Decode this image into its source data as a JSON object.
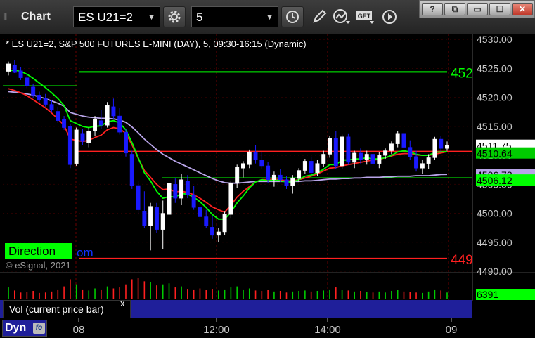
{
  "toolbar": {
    "title": "Chart",
    "symbol": "ES U21=2",
    "interval": "5"
  },
  "window_controls": {
    "help": "?",
    "restore": "⧉",
    "minimize": "▭",
    "maximize": "☐",
    "close": "✕"
  },
  "chart": {
    "header": "* ES U21=2, S&P 500 FUTURES E-MINI (DAY), 5, 09:30-16:15 (Dynamic)",
    "direction_label": "Direction",
    "direction_tail": "om",
    "copyright": "© eSignal, 2021",
    "price_ticks": [
      "4530.00",
      "4525.00",
      "4520.00",
      "4515.00",
      "4510.00",
      "4505.00",
      "4500.00",
      "4495.00",
      "4490.00"
    ],
    "time_ticks": [
      "08",
      "12:00",
      "14:00",
      "09"
    ],
    "line_labels": {
      "upper": "452",
      "lower": "449"
    },
    "price_tags": [
      {
        "text": "4511.75",
        "bg": "#ffffff",
        "fg": "#000000"
      },
      {
        "text": "4510.64",
        "bg": "#00cc00",
        "fg": "#000000"
      },
      {
        "text": "4506.72",
        "bg": "#b8a4e8",
        "fg": "#000000"
      },
      {
        "text": "4506.12",
        "bg": "#00ff00",
        "fg": "#000000"
      }
    ],
    "volume": {
      "label": "Vol (current price bar)",
      "close_glyph": "x",
      "value": "6391"
    },
    "bottom": {
      "dyn_label": "Dyn",
      "dyn_icon_text": "fo"
    },
    "colors": {
      "up_candle": "#ffffff",
      "down_candle": "#1a1aff",
      "ma_red": "#ff2020",
      "ma_green": "#00ff00",
      "ma_purple": "#b8a4e8",
      "level_green": "#00ff00",
      "level_red": "#ff2020",
      "grid": "#6a0000"
    }
  },
  "chart_data": {
    "type": "candlestick",
    "symbol": "ES U21=2",
    "ylim": [
      4490,
      4531
    ],
    "levels": {
      "upper_green": 4524.4,
      "lower_red": 4492.2,
      "red_mid": 4510.7,
      "green_mid": 4506.1
    },
    "candles": [
      [
        4524.5,
        4526.2,
        4523.8,
        4525.8
      ],
      [
        4525.6,
        4526.4,
        4524.2,
        4524.3
      ],
      [
        4524.6,
        4525.2,
        4523.0,
        4523.4
      ],
      [
        4523.4,
        4524.0,
        4521.6,
        4522.0
      ],
      [
        4521.8,
        4522.4,
        4520.0,
        4520.4
      ],
      [
        4520.4,
        4521.0,
        4519.2,
        4519.6
      ],
      [
        4519.8,
        4520.6,
        4518.4,
        4518.8
      ],
      [
        4518.8,
        4519.6,
        4517.4,
        4517.8
      ],
      [
        4517.6,
        4518.4,
        4515.6,
        4516.0
      ],
      [
        4516.2,
        4516.8,
        4514.4,
        4514.8
      ],
      [
        4515.0,
        4515.4,
        4507.8,
        4508.4
      ],
      [
        4508.6,
        4514.8,
        4508.2,
        4514.4
      ],
      [
        4513.8,
        4514.6,
        4511.8,
        4512.4
      ],
      [
        4512.2,
        4514.8,
        4511.4,
        4514.2
      ],
      [
        4514.2,
        4516.8,
        4513.4,
        4516.2
      ],
      [
        4516.0,
        4517.8,
        4514.6,
        4515.2
      ],
      [
        4515.2,
        4519.2,
        4514.8,
        4518.6
      ],
      [
        4518.4,
        4519.8,
        4516.2,
        4516.8
      ],
      [
        4516.8,
        4518.2,
        4513.6,
        4514.0
      ],
      [
        4514.0,
        4514.6,
        4509.8,
        4510.4
      ],
      [
        4510.2,
        4510.8,
        4504.2,
        4504.8
      ],
      [
        4504.8,
        4505.6,
        4499.8,
        4500.6
      ],
      [
        4500.4,
        4503.8,
        4497.4,
        4497.8
      ],
      [
        4497.8,
        4501.8,
        4493.6,
        4501.2
      ],
      [
        4501.0,
        4501.8,
        4496.6,
        4497.2
      ],
      [
        4497.2,
        4502.2,
        4493.8,
        4500.0
      ],
      [
        4499.8,
        4505.8,
        4497.4,
        4505.2
      ],
      [
        4505.0,
        4506.0,
        4501.8,
        4502.6
      ],
      [
        4502.6,
        4506.8,
        4501.4,
        4505.8
      ],
      [
        4505.6,
        4506.6,
        4502.6,
        4503.2
      ],
      [
        4503.2,
        4504.8,
        4500.6,
        4501.0
      ],
      [
        4501.0,
        4502.6,
        4498.6,
        4499.4
      ],
      [
        4499.4,
        4500.6,
        4497.4,
        4497.8
      ],
      [
        4497.6,
        4499.6,
        4495.6,
        4496.2
      ],
      [
        4496.2,
        4497.4,
        4495.0,
        4496.8
      ],
      [
        4496.8,
        4500.4,
        4496.2,
        4499.8
      ],
      [
        4499.8,
        4505.6,
        4499.2,
        4505.2
      ],
      [
        4505.2,
        4508.4,
        4504.4,
        4508.0
      ],
      [
        4507.8,
        4509.0,
        4506.2,
        4508.6
      ],
      [
        4508.4,
        4511.0,
        4507.8,
        4510.6
      ],
      [
        4510.6,
        4511.8,
        4508.6,
        4509.2
      ],
      [
        4509.2,
        4510.6,
        4507.6,
        4508.2
      ],
      [
        4508.2,
        4508.8,
        4505.2,
        4505.8
      ],
      [
        4505.8,
        4507.2,
        4504.6,
        4506.6
      ],
      [
        4506.6,
        4507.6,
        4505.4,
        4505.8
      ],
      [
        4505.8,
        4506.4,
        4504.2,
        4504.8
      ],
      [
        4504.8,
        4506.6,
        4503.4,
        4506.0
      ],
      [
        4506.0,
        4507.8,
        4505.4,
        4507.4
      ],
      [
        4507.4,
        4509.4,
        4506.8,
        4509.0
      ],
      [
        4509.0,
        4509.8,
        4506.4,
        4507.0
      ],
      [
        4507.0,
        4509.2,
        4506.4,
        4508.6
      ],
      [
        4508.6,
        4510.8,
        4508.0,
        4510.2
      ],
      [
        4510.2,
        4513.4,
        4509.6,
        4513.0
      ],
      [
        4513.0,
        4514.2,
        4507.6,
        4508.2
      ],
      [
        4508.2,
        4513.6,
        4507.6,
        4513.2
      ],
      [
        4513.2,
        4513.8,
        4508.4,
        4508.8
      ],
      [
        4508.8,
        4510.8,
        4507.8,
        4510.4
      ],
      [
        4510.4,
        4511.2,
        4508.6,
        4509.2
      ],
      [
        4509.2,
        4510.8,
        4508.4,
        4510.2
      ],
      [
        4510.2,
        4510.8,
        4508.2,
        4508.6
      ],
      [
        4508.6,
        4510.6,
        4507.8,
        4510.0
      ],
      [
        4510.0,
        4511.2,
        4509.4,
        4510.8
      ],
      [
        4510.8,
        4512.4,
        4510.2,
        4512.0
      ],
      [
        4512.0,
        4514.2,
        4511.4,
        4513.8
      ],
      [
        4513.8,
        4514.6,
        4510.8,
        4511.4
      ],
      [
        4511.4,
        4512.6,
        4509.2,
        4509.8
      ],
      [
        4509.8,
        4510.8,
        4507.2,
        4507.8
      ],
      [
        4507.8,
        4509.2,
        4506.8,
        4508.6
      ],
      [
        4508.6,
        4510.2,
        4507.6,
        4509.6
      ],
      [
        4509.6,
        4513.2,
        4509.2,
        4512.8
      ],
      [
        4512.8,
        4513.4,
        4510.6,
        4511.2
      ],
      [
        4511.2,
        4512.4,
        4510.8,
        4511.75
      ]
    ],
    "ma_red": [
      4521.5,
      4521.2,
      4520.8,
      4520.3,
      4519.6,
      4518.9,
      4518.2,
      4517.3,
      4516.3,
      4515.2,
      4512.8,
      4512.6,
      4512.4,
      4512.6,
      4513.1,
      4513.5,
      4514.4,
      4514.8,
      4514.6,
      4513.8,
      4511.8,
      4509.5,
      4507.4,
      4506.2,
      4505.0,
      4504.1,
      4504.2,
      4503.7,
      4503.8,
      4503.6,
      4503.2,
      4502.6,
      4501.9,
      4501.1,
      4500.6,
      4500.2,
      4501.4,
      4502.8,
      4503.8,
      4504.6,
      4505.4,
      4505.8,
      4505.8,
      4505.9,
      4505.8,
      4505.6,
      4505.6,
      4505.8,
      4506.1,
      4506.4,
      4506.8,
      4507.3,
      4507.8,
      4507.9,
      4508.2,
      4508.4,
      4508.6,
      4508.8,
      4509.0,
      4509.2,
      4509.3,
      4509.6,
      4509.9,
      4510.2,
      4510.3,
      4510.3,
      4510.1,
      4510.0,
      4510.0,
      4510.2,
      4510.4,
      4510.64
    ],
    "ma_green": [
      4524.6,
      4524.7,
      4524.5,
      4524.0,
      4523.3,
      4522.5,
      4521.7,
      4520.8,
      4519.8,
      4518.6,
      4516.0,
      4515.5,
      4515.0,
      4514.8,
      4515.0,
      4515.1,
      4515.8,
      4516.0,
      4515.6,
      4514.4,
      4512.2,
      4509.6,
      4507.0,
      4505.6,
      4503.8,
      4502.6,
      4502.9,
      4502.8,
      4503.4,
      4503.3,
      4502.8,
      4502.0,
      4501.0,
      4499.8,
      4499.0,
      4499.0,
      4500.2,
      4501.8,
      4503.0,
      4504.4,
      4505.4,
      4505.8,
      4505.6,
      4505.8,
      4505.6,
      4505.4,
      4505.4,
      4505.8,
      4506.4,
      4506.6,
      4507.0,
      4507.6,
      4508.4,
      4508.4,
      4509.2,
      4509.2,
      4509.4,
      4509.4,
      4509.6,
      4509.4,
      4509.4,
      4509.6,
      4510.0,
      4510.6,
      4510.8,
      4510.6,
      4510.2,
      4510.0,
      4510.0,
      4510.5,
      4510.6,
      4510.64
    ],
    "ma_purple": [
      4521.0,
      4520.9,
      4520.8,
      4520.6,
      4520.4,
      4520.1,
      4519.8,
      4519.4,
      4519.0,
      4518.5,
      4517.4,
      4517.1,
      4516.8,
      4516.6,
      4516.5,
      4516.4,
      4516.4,
      4516.3,
      4516.1,
      4515.7,
      4514.9,
      4513.9,
      4512.8,
      4511.9,
      4511.0,
      4510.2,
      4509.6,
      4509.0,
      4508.5,
      4508.0,
      4507.5,
      4507.0,
      4506.5,
      4506.0,
      4505.6,
      4505.3,
      4505.2,
      4505.2,
      4505.3,
      4505.4,
      4505.5,
      4505.5,
      4505.5,
      4505.5,
      4505.5,
      4505.5,
      4505.5,
      4505.5,
      4505.6,
      4505.6,
      4505.7,
      4505.8,
      4505.9,
      4505.9,
      4506.0,
      4506.0,
      4506.1,
      4506.1,
      4506.2,
      4506.2,
      4506.2,
      4506.3,
      4506.3,
      4506.4,
      4506.4,
      4506.4,
      4506.5,
      4506.5,
      4506.5,
      4506.6,
      4506.7,
      4506.72
    ],
    "volumes": [
      55,
      40,
      30,
      32,
      38,
      28,
      30,
      35,
      45,
      60,
      95,
      70,
      45,
      40,
      50,
      45,
      60,
      50,
      55,
      70,
      95,
      100,
      85,
      80,
      65,
      70,
      75,
      55,
      60,
      48,
      45,
      50,
      42,
      48,
      40,
      45,
      55,
      60,
      45,
      50,
      40,
      38,
      42,
      35,
      38,
      30,
      35,
      38,
      40,
      35,
      38,
      40,
      45,
      55,
      42,
      40,
      35,
      38,
      32,
      30,
      35,
      30,
      38,
      42,
      35,
      32,
      30,
      28,
      35,
      45,
      40,
      30
    ],
    "visible_volume": 6391
  }
}
